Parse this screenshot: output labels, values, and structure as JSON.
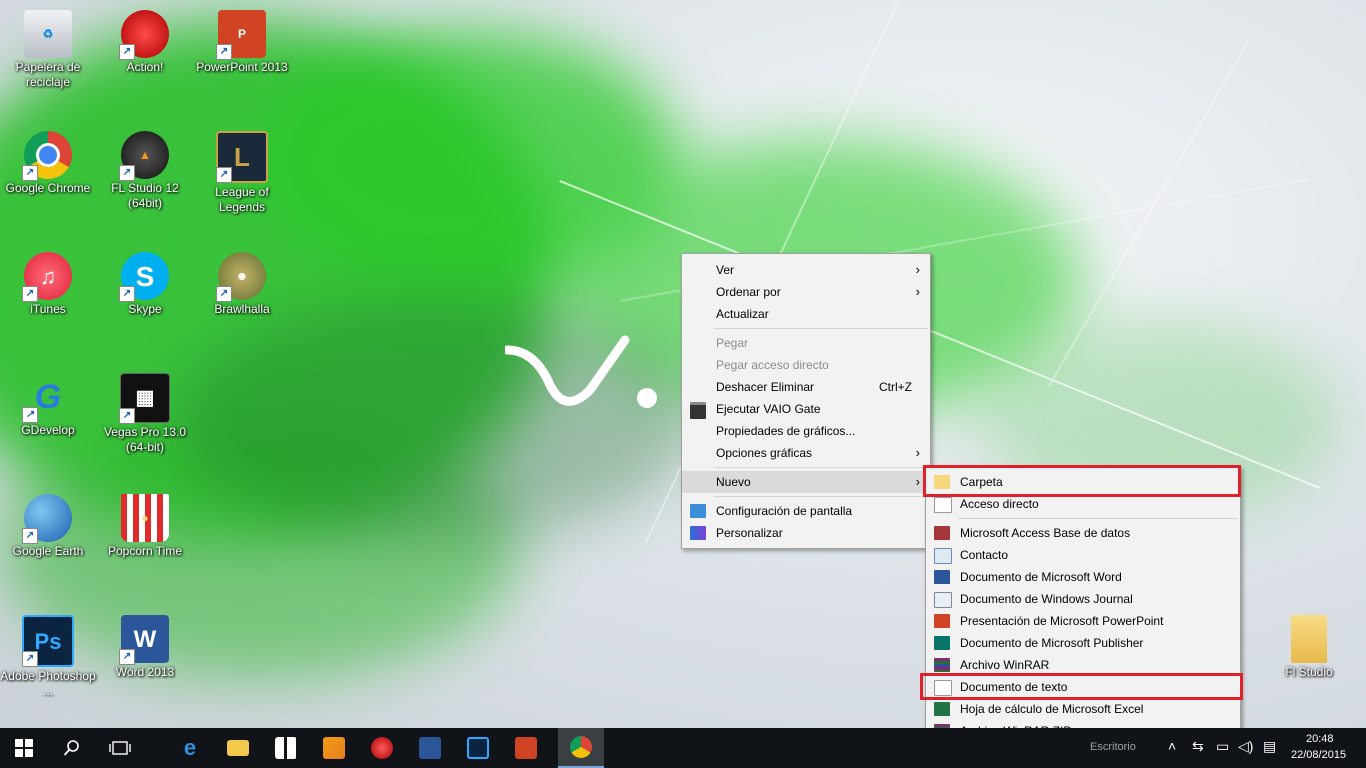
{
  "desktop_icons": [
    {
      "label": "Papelera de reciclaje",
      "icon": "recycle-bin-icon",
      "color": "#d8dde4"
    },
    {
      "label": "Action!",
      "icon": "action-icon",
      "color": "#cc1f1f"
    },
    {
      "label": "PowerPoint 2013",
      "icon": "powerpoint-icon",
      "color": "#d04423"
    },
    {
      "label": "Google Chrome",
      "icon": "chrome-icon",
      "color": "#dd4b39"
    },
    {
      "label": "FL Studio 12 (64bit)",
      "icon": "fl-studio-icon",
      "color": "#222222"
    },
    {
      "label": "League of Legends",
      "icon": "league-of-legends-icon",
      "color": "#1b2a3a"
    },
    {
      "label": "iTunes",
      "icon": "itunes-icon",
      "color": "#f2394f"
    },
    {
      "label": "Skype",
      "icon": "skype-icon",
      "color": "#00aff0"
    },
    {
      "label": "Brawlhalla",
      "icon": "brawlhalla-icon",
      "color": "#6d7f3a"
    },
    {
      "label": "GDevelop",
      "icon": "gdevelop-icon",
      "color": "#1f6fc0"
    },
    {
      "label": "Vegas Pro 13.0 (64-bit)",
      "icon": "vegas-pro-icon",
      "color": "#111111"
    },
    {
      "label": "Google Earth",
      "icon": "google-earth-icon",
      "color": "#2a6cc4"
    },
    {
      "label": "Popcorn Time",
      "icon": "popcorn-time-icon",
      "color": "#e02b2b"
    },
    {
      "label": "Adobe Photoshop ...",
      "icon": "photoshop-icon",
      "color": "#0b2440"
    },
    {
      "label": "Word 2013",
      "icon": "word-icon",
      "color": "#2b579a"
    },
    {
      "label": "Fl Studio",
      "icon": "folder-icon",
      "color": "#f2cf6b"
    }
  ],
  "context_menu": {
    "items": [
      {
        "label": "Ver"
      },
      {
        "label": "Ordenar por"
      },
      {
        "label": "Actualizar"
      },
      {
        "label": "Pegar"
      },
      {
        "label": "Pegar acceso directo"
      },
      {
        "label": "Deshacer Eliminar",
        "shortcut": "Ctrl+Z"
      },
      {
        "label": "Ejecutar VAIO Gate"
      },
      {
        "label": "Propiedades de gráficos..."
      },
      {
        "label": "Opciones gráficas"
      },
      {
        "label": "Nuevo"
      },
      {
        "label": "Configuración de pantalla"
      },
      {
        "label": "Personalizar"
      }
    ]
  },
  "submenu_nuevo": {
    "items": [
      {
        "label": "Carpeta"
      },
      {
        "label": "Acceso directo"
      },
      {
        "label": "Microsoft Access Base de datos"
      },
      {
        "label": "Contacto"
      },
      {
        "label": "Documento de Microsoft Word"
      },
      {
        "label": "Documento de Windows Journal"
      },
      {
        "label": "Presentación de Microsoft PowerPoint"
      },
      {
        "label": "Documento de Microsoft Publisher"
      },
      {
        "label": "Archivo WinRAR"
      },
      {
        "label": "Documento de texto"
      },
      {
        "label": "Hoja de cálculo de Microsoft Excel"
      },
      {
        "label": "Archivo WinRAR ZIP"
      }
    ]
  },
  "taskbar": {
    "tray_partial": "Escritorio",
    "time": "20:48",
    "date": "22/08/2015"
  },
  "colors": {
    "highlight_box": "#e0202a",
    "taskbar": "#101418"
  }
}
